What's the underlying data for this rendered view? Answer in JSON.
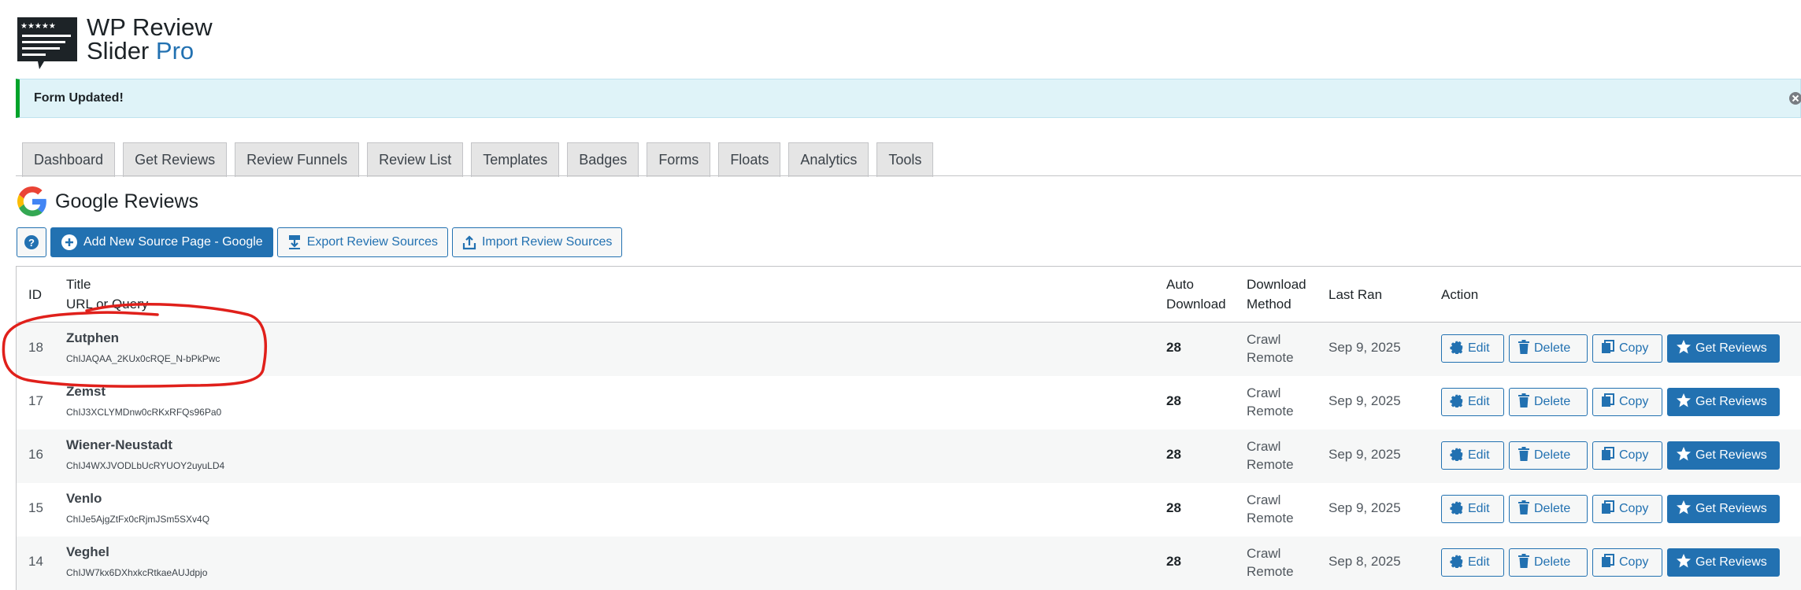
{
  "logo": {
    "line1": "WP Review",
    "line2_main": "Slider",
    "line2_accent": "Pro"
  },
  "notice": {
    "text": "Form Updated!"
  },
  "tabs": [
    {
      "label": "Dashboard"
    },
    {
      "label": "Get Reviews"
    },
    {
      "label": "Review Funnels"
    },
    {
      "label": "Review List"
    },
    {
      "label": "Templates"
    },
    {
      "label": "Badges"
    },
    {
      "label": "Forms"
    },
    {
      "label": "Floats"
    },
    {
      "label": "Analytics"
    },
    {
      "label": "Tools"
    }
  ],
  "page": {
    "title": "Google Reviews"
  },
  "toolbar": {
    "help_label": "?",
    "add_label": "Add New Source Page - Google",
    "export_label": "Export Review Sources",
    "import_label": "Import Review Sources"
  },
  "table": {
    "headers": {
      "id": "ID",
      "title": "Title",
      "url": "URL or Query",
      "auto1": "Auto",
      "auto2": "Download",
      "method1": "Download",
      "method2": "Method",
      "last_ran": "Last Ran",
      "action": "Action"
    },
    "action_labels": {
      "edit": "Edit",
      "delete": "Delete",
      "copy": "Copy",
      "get": "Get Reviews"
    },
    "rows": [
      {
        "id": "18",
        "title": "Zutphen",
        "query": "ChIJAQAA_2KUx0cRQE_N-bPkPwc",
        "auto": "28",
        "method1": "Crawl",
        "method2": "Remote",
        "last_ran": "Sep 9, 2025"
      },
      {
        "id": "17",
        "title": "Zemst",
        "query": "ChIJ3XCLYMDnw0cRKxRFQs96Pa0",
        "auto": "28",
        "method1": "Crawl",
        "method2": "Remote",
        "last_ran": "Sep 9, 2025"
      },
      {
        "id": "16",
        "title": "Wiener-Neustadt",
        "query": "ChIJ4WXJVODLbUcRYUOY2uyuLD4",
        "auto": "28",
        "method1": "Crawl",
        "method2": "Remote",
        "last_ran": "Sep 9, 2025"
      },
      {
        "id": "15",
        "title": "Venlo",
        "query": "ChIJe5AjgZtFx0cRjmJSm5SXv4Q",
        "auto": "28",
        "method1": "Crawl",
        "method2": "Remote",
        "last_ran": "Sep 9, 2025"
      },
      {
        "id": "14",
        "title": "Veghel",
        "query": "ChIJW7kx6DXhxkcRtkaeAUJdpjo",
        "auto": "28",
        "method1": "Crawl",
        "method2": "Remote",
        "last_ran": "Sep 8, 2025"
      }
    ]
  },
  "colors": {
    "accent": "#2271b1",
    "notice_bg": "#dff3f8",
    "notice_border": "#00a32a",
    "annotation": "#e0201b"
  }
}
